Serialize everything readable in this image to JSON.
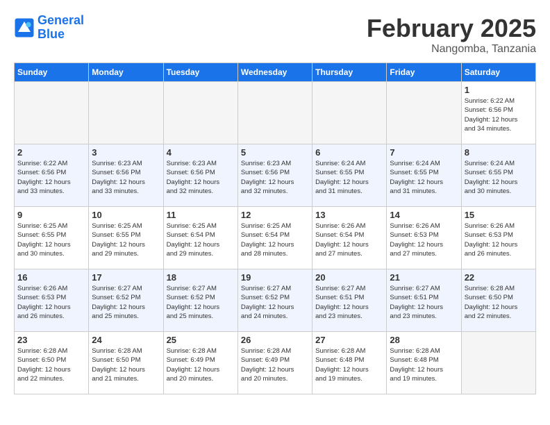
{
  "header": {
    "logo_line1": "General",
    "logo_line2": "Blue",
    "month": "February 2025",
    "location": "Nangomba, Tanzania"
  },
  "days_of_week": [
    "Sunday",
    "Monday",
    "Tuesday",
    "Wednesday",
    "Thursday",
    "Friday",
    "Saturday"
  ],
  "weeks": [
    [
      {
        "num": "",
        "info": ""
      },
      {
        "num": "",
        "info": ""
      },
      {
        "num": "",
        "info": ""
      },
      {
        "num": "",
        "info": ""
      },
      {
        "num": "",
        "info": ""
      },
      {
        "num": "",
        "info": ""
      },
      {
        "num": "1",
        "info": "Sunrise: 6:22 AM\nSunset: 6:56 PM\nDaylight: 12 hours\nand 34 minutes."
      }
    ],
    [
      {
        "num": "2",
        "info": "Sunrise: 6:22 AM\nSunset: 6:56 PM\nDaylight: 12 hours\nand 33 minutes."
      },
      {
        "num": "3",
        "info": "Sunrise: 6:23 AM\nSunset: 6:56 PM\nDaylight: 12 hours\nand 33 minutes."
      },
      {
        "num": "4",
        "info": "Sunrise: 6:23 AM\nSunset: 6:56 PM\nDaylight: 12 hours\nand 32 minutes."
      },
      {
        "num": "5",
        "info": "Sunrise: 6:23 AM\nSunset: 6:56 PM\nDaylight: 12 hours\nand 32 minutes."
      },
      {
        "num": "6",
        "info": "Sunrise: 6:24 AM\nSunset: 6:55 PM\nDaylight: 12 hours\nand 31 minutes."
      },
      {
        "num": "7",
        "info": "Sunrise: 6:24 AM\nSunset: 6:55 PM\nDaylight: 12 hours\nand 31 minutes."
      },
      {
        "num": "8",
        "info": "Sunrise: 6:24 AM\nSunset: 6:55 PM\nDaylight: 12 hours\nand 30 minutes."
      }
    ],
    [
      {
        "num": "9",
        "info": "Sunrise: 6:25 AM\nSunset: 6:55 PM\nDaylight: 12 hours\nand 30 minutes."
      },
      {
        "num": "10",
        "info": "Sunrise: 6:25 AM\nSunset: 6:55 PM\nDaylight: 12 hours\nand 29 minutes."
      },
      {
        "num": "11",
        "info": "Sunrise: 6:25 AM\nSunset: 6:54 PM\nDaylight: 12 hours\nand 29 minutes."
      },
      {
        "num": "12",
        "info": "Sunrise: 6:25 AM\nSunset: 6:54 PM\nDaylight: 12 hours\nand 28 minutes."
      },
      {
        "num": "13",
        "info": "Sunrise: 6:26 AM\nSunset: 6:54 PM\nDaylight: 12 hours\nand 27 minutes."
      },
      {
        "num": "14",
        "info": "Sunrise: 6:26 AM\nSunset: 6:53 PM\nDaylight: 12 hours\nand 27 minutes."
      },
      {
        "num": "15",
        "info": "Sunrise: 6:26 AM\nSunset: 6:53 PM\nDaylight: 12 hours\nand 26 minutes."
      }
    ],
    [
      {
        "num": "16",
        "info": "Sunrise: 6:26 AM\nSunset: 6:53 PM\nDaylight: 12 hours\nand 26 minutes."
      },
      {
        "num": "17",
        "info": "Sunrise: 6:27 AM\nSunset: 6:52 PM\nDaylight: 12 hours\nand 25 minutes."
      },
      {
        "num": "18",
        "info": "Sunrise: 6:27 AM\nSunset: 6:52 PM\nDaylight: 12 hours\nand 25 minutes."
      },
      {
        "num": "19",
        "info": "Sunrise: 6:27 AM\nSunset: 6:52 PM\nDaylight: 12 hours\nand 24 minutes."
      },
      {
        "num": "20",
        "info": "Sunrise: 6:27 AM\nSunset: 6:51 PM\nDaylight: 12 hours\nand 23 minutes."
      },
      {
        "num": "21",
        "info": "Sunrise: 6:27 AM\nSunset: 6:51 PM\nDaylight: 12 hours\nand 23 minutes."
      },
      {
        "num": "22",
        "info": "Sunrise: 6:28 AM\nSunset: 6:50 PM\nDaylight: 12 hours\nand 22 minutes."
      }
    ],
    [
      {
        "num": "23",
        "info": "Sunrise: 6:28 AM\nSunset: 6:50 PM\nDaylight: 12 hours\nand 22 minutes."
      },
      {
        "num": "24",
        "info": "Sunrise: 6:28 AM\nSunset: 6:50 PM\nDaylight: 12 hours\nand 21 minutes."
      },
      {
        "num": "25",
        "info": "Sunrise: 6:28 AM\nSunset: 6:49 PM\nDaylight: 12 hours\nand 20 minutes."
      },
      {
        "num": "26",
        "info": "Sunrise: 6:28 AM\nSunset: 6:49 PM\nDaylight: 12 hours\nand 20 minutes."
      },
      {
        "num": "27",
        "info": "Sunrise: 6:28 AM\nSunset: 6:48 PM\nDaylight: 12 hours\nand 19 minutes."
      },
      {
        "num": "28",
        "info": "Sunrise: 6:28 AM\nSunset: 6:48 PM\nDaylight: 12 hours\nand 19 minutes."
      },
      {
        "num": "",
        "info": ""
      }
    ]
  ]
}
